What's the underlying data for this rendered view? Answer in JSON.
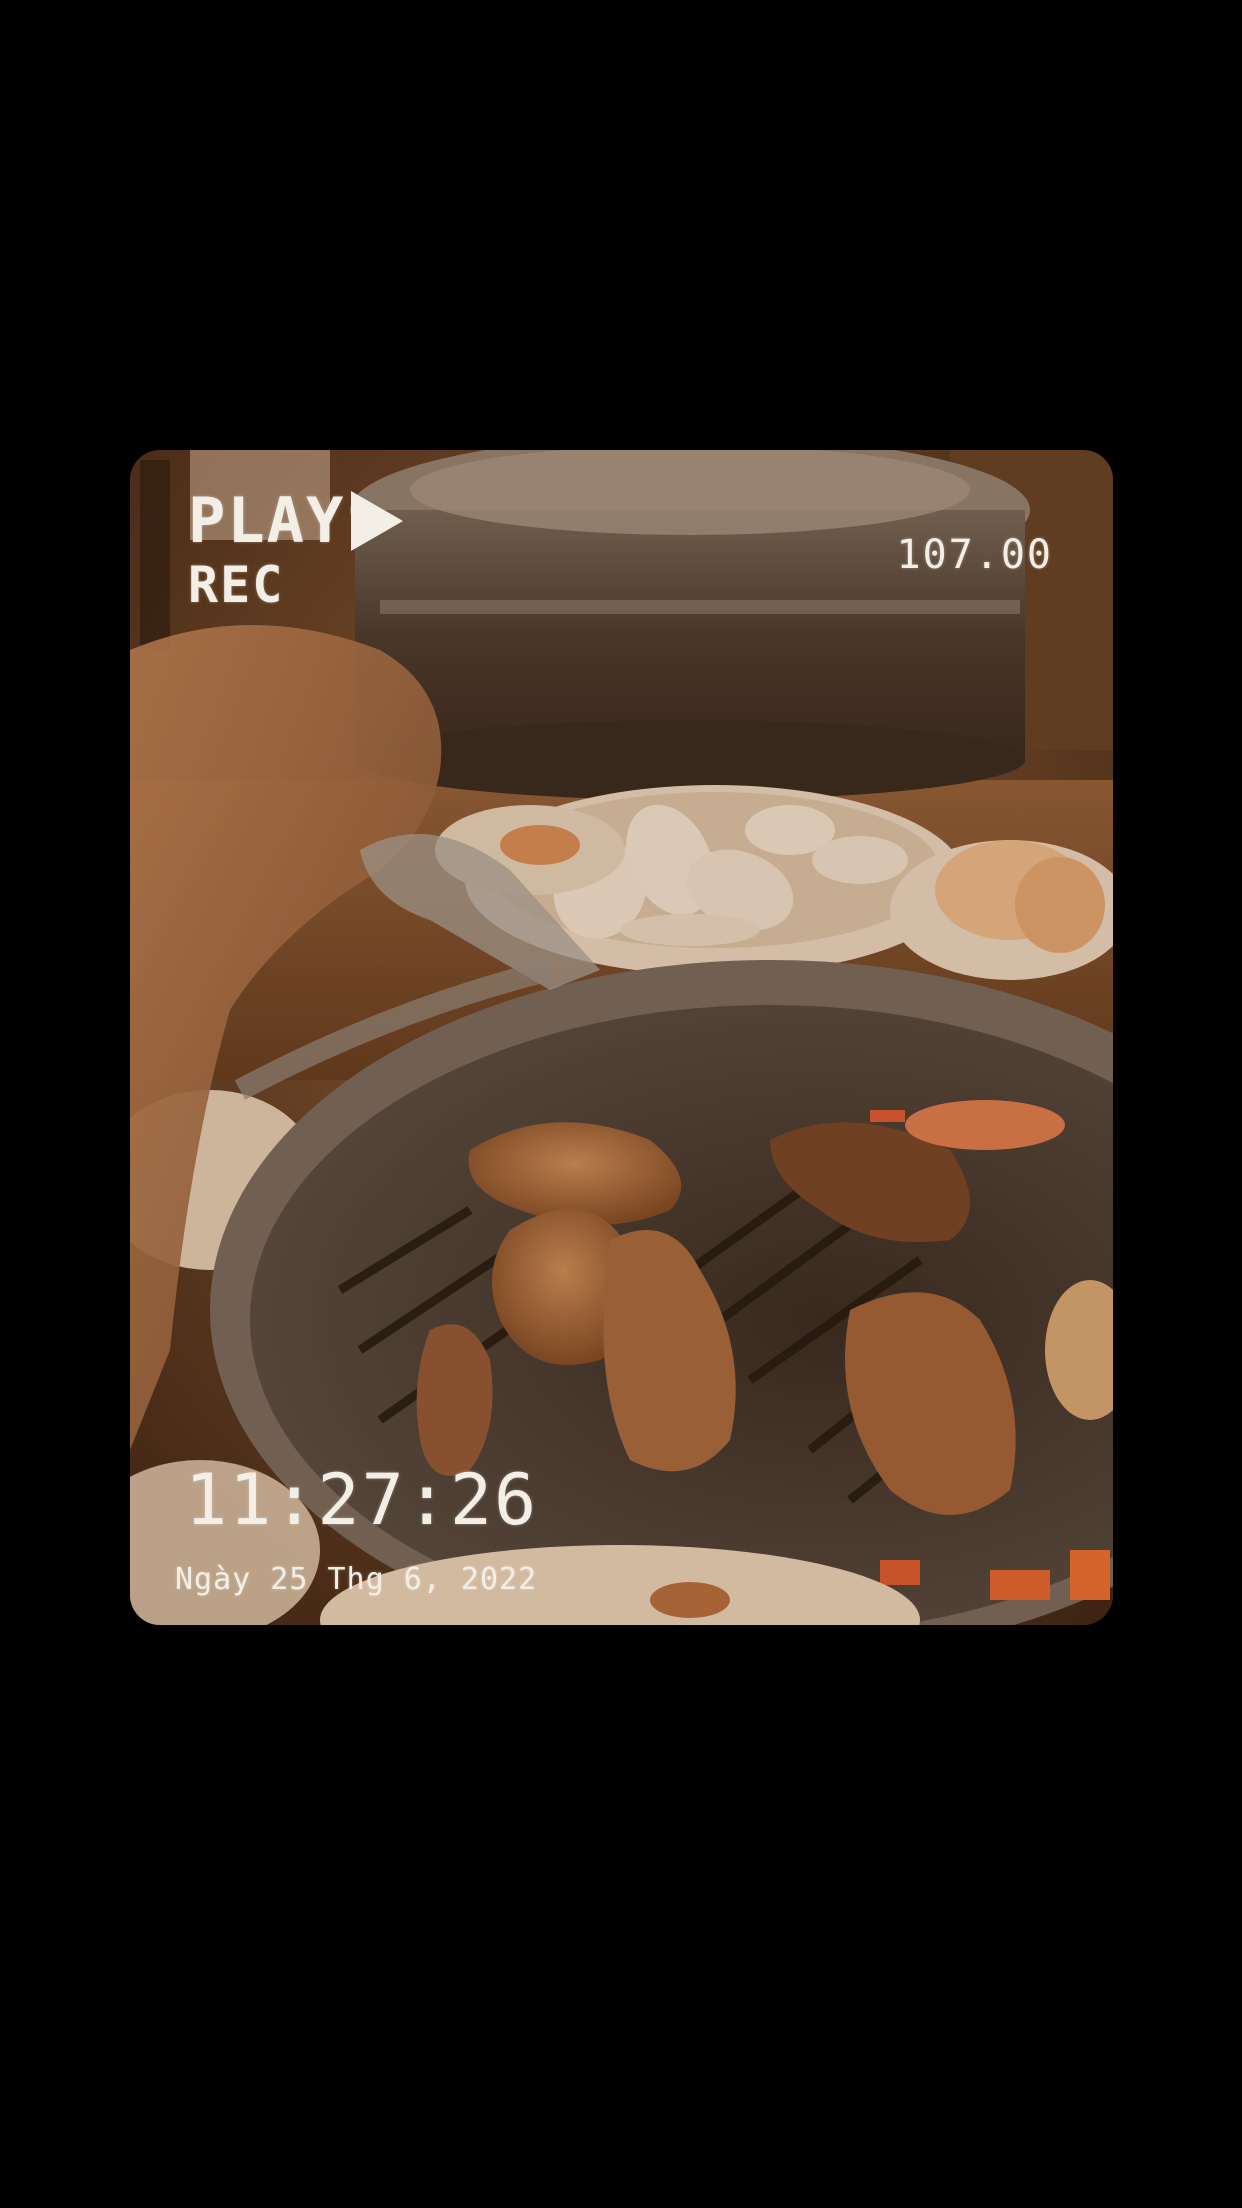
{
  "overlay": {
    "play_label": "PLAY",
    "rec_label": "REC",
    "counter": "107.00",
    "time": "11:27:26",
    "date": "Ngày 25 Thg 6, 2022",
    "play_icon": "play-triangle-icon"
  },
  "photo": {
    "subject": "korean-bbq-grill-scene"
  },
  "colors": {
    "background": "#000000",
    "osd_text": "#f4efe6",
    "photo_tone": "#7a4a28"
  }
}
